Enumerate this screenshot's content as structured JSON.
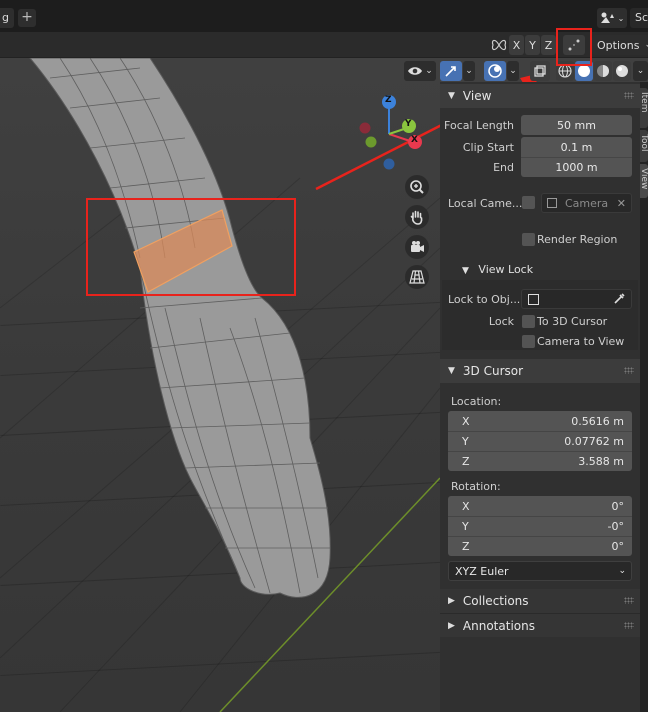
{
  "topbar": {
    "tab_fragment": "g",
    "add_tab": "+",
    "scene_fragment": "Sc"
  },
  "header": {
    "axis_x": "X",
    "axis_y": "Y",
    "axis_z": "Z",
    "options_label": "Options"
  },
  "sidebar": {
    "view_panel": {
      "title": "View",
      "focal_length_label": "Focal Length",
      "focal_length_value": "50 mm",
      "clip_start_label": "Clip Start",
      "clip_start_value": "0.1 m",
      "clip_end_label": "End",
      "clip_end_value": "1000 m",
      "local_camera_label": "Local Came...",
      "camera_placeholder": "Camera",
      "render_region_label": "Render Region"
    },
    "view_lock": {
      "title": "View Lock",
      "lock_to_object_label": "Lock to Obj...",
      "lock_label": "Lock",
      "to_3d_cursor_label": "To 3D Cursor",
      "camera_to_view_label": "Camera to View"
    },
    "cursor_panel": {
      "title": "3D Cursor",
      "location_label": "Location:",
      "location": [
        {
          "axis": "X",
          "value": "0.5616 m"
        },
        {
          "axis": "Y",
          "value": "0.07762 m"
        },
        {
          "axis": "Z",
          "value": "3.588 m"
        }
      ],
      "rotation_label": "Rotation:",
      "rotation": [
        {
          "axis": "X",
          "value": "0°"
        },
        {
          "axis": "Y",
          "value": "-0°"
        },
        {
          "axis": "Z",
          "value": "0°"
        }
      ],
      "rotation_mode": "XYZ Euler"
    },
    "collections_title": "Collections",
    "annotations_title": "Annotations"
  },
  "tabs": [
    "Item",
    "Tool",
    "View"
  ],
  "gizmo": {
    "x_label": "X",
    "y_label": "Y",
    "z_label": "Z",
    "x_color": "#e8394e",
    "y_color": "#8ac53e",
    "z_color": "#3c82db"
  },
  "colors": {
    "accent": "#4772b3",
    "annotation_red": "#e8231c",
    "selection_orange": "#e88a3c"
  }
}
